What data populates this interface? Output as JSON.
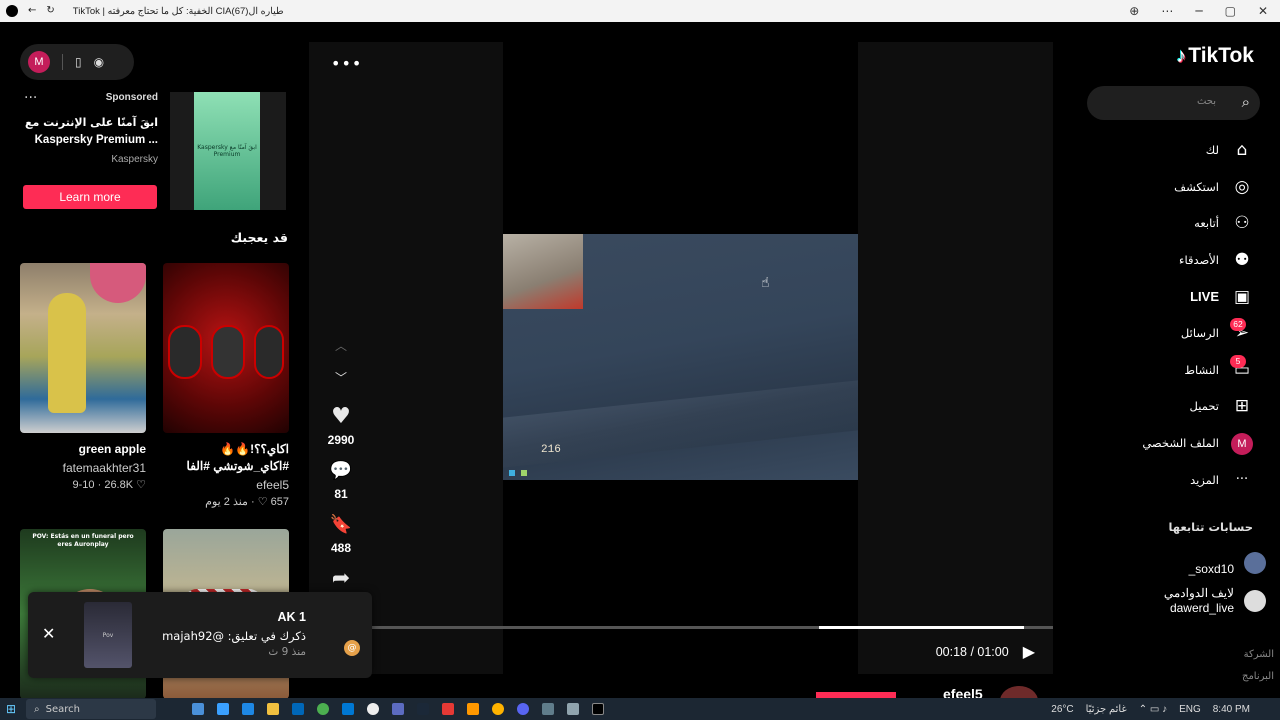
{
  "window": {
    "title": "TikTok | الخفية: كل ما تحتاج معرفته CIAطياره ال(67)",
    "icons": [
      "back-arrow-icon",
      "reload-icon",
      "zoom-icon",
      "extensions-icon",
      "minimize-icon",
      "maximize-icon",
      "close-icon"
    ]
  },
  "top_pill": {
    "avatar_letter": "M"
  },
  "ad": {
    "sponsored_label": "Sponsored",
    "line1": "ابقَ آمنًا على الإنترنت مع",
    "line2": "Kaspersky Premium ...",
    "brand": "Kaspersky",
    "cta": "Learn more",
    "thumb_text": "ابقَ آمنًا مع Kaspersky Premium"
  },
  "suggestions": {
    "heading": "قد يعجبك",
    "cards": [
      {
        "title": "green apple",
        "author": "fatemaakhter31",
        "stats": "9-10 · 26.8K ♡",
        "theme": "market"
      },
      {
        "title": "اكاي؟؟!🔥🔥#اكاي_شوتشي #الفا #عبدلله_المهنا...",
        "author": "efeel5",
        "stats": "657 ♡ · منذ 2 يوم",
        "theme": "red"
      },
      {
        "title": "POV: Estás en un funeral pero eres Auronplay",
        "author": "",
        "stats": "",
        "theme": "green"
      },
      {
        "title": "",
        "author": "",
        "stats": "",
        "theme": "desert"
      }
    ]
  },
  "video": {
    "hud_value": "216",
    "actions": [
      {
        "name": "like",
        "icon": "♥",
        "count": "2990"
      },
      {
        "name": "comment",
        "icon": "💬",
        "count": "81"
      },
      {
        "name": "bookmark",
        "icon": "🔖",
        "count": "488"
      },
      {
        "name": "share",
        "icon": "➦",
        "count": ""
      }
    ],
    "progress": 0.3,
    "time": "00:18 / 01:00"
  },
  "toast": {
    "name": "AK 1",
    "message": "ذكرك في تعليق: @majah92",
    "time": "منذ 9 ث",
    "thumb_text": "Pov"
  },
  "nav": {
    "logo": "TikTok",
    "search_placeholder": "بحث",
    "items": [
      {
        "label": "لك",
        "icon": "home-icon",
        "glyph": "⌂"
      },
      {
        "label": "استكشف",
        "icon": "compass-icon",
        "glyph": "◎"
      },
      {
        "label": "أتابعه",
        "icon": "following-icon",
        "glyph": "⚇"
      },
      {
        "label": "الأصدقاء",
        "icon": "friends-icon",
        "glyph": "⚉"
      },
      {
        "label": "LIVE",
        "icon": "live-icon",
        "glyph": "▣"
      },
      {
        "label": "الرسائل",
        "icon": "messages-icon",
        "glyph": "➢",
        "badge": "62"
      },
      {
        "label": "النشاط",
        "icon": "activity-icon",
        "glyph": "▭",
        "badge": "5"
      },
      {
        "label": "تحميل",
        "icon": "upload-icon",
        "glyph": "⊞"
      },
      {
        "label": "الملف الشخصي",
        "icon": "profile-avatar",
        "glyph": "M"
      },
      {
        "label": "المزيد",
        "icon": "more-icon",
        "glyph": "···"
      }
    ],
    "following_heading": "حسابات تتابعها",
    "following": [
      {
        "name": "_soxd10"
      },
      {
        "name": "لايف الدوادمي",
        "handle": "dawerd_live"
      }
    ],
    "footer": [
      "الشركة",
      "البرنامج"
    ]
  },
  "next_video": {
    "author": "efeel5"
  },
  "taskbar": {
    "search_label": "Search",
    "weather": "26°C",
    "news": "غائم جزئيًا",
    "lang": "ENG",
    "clock": "8:40 PM"
  }
}
